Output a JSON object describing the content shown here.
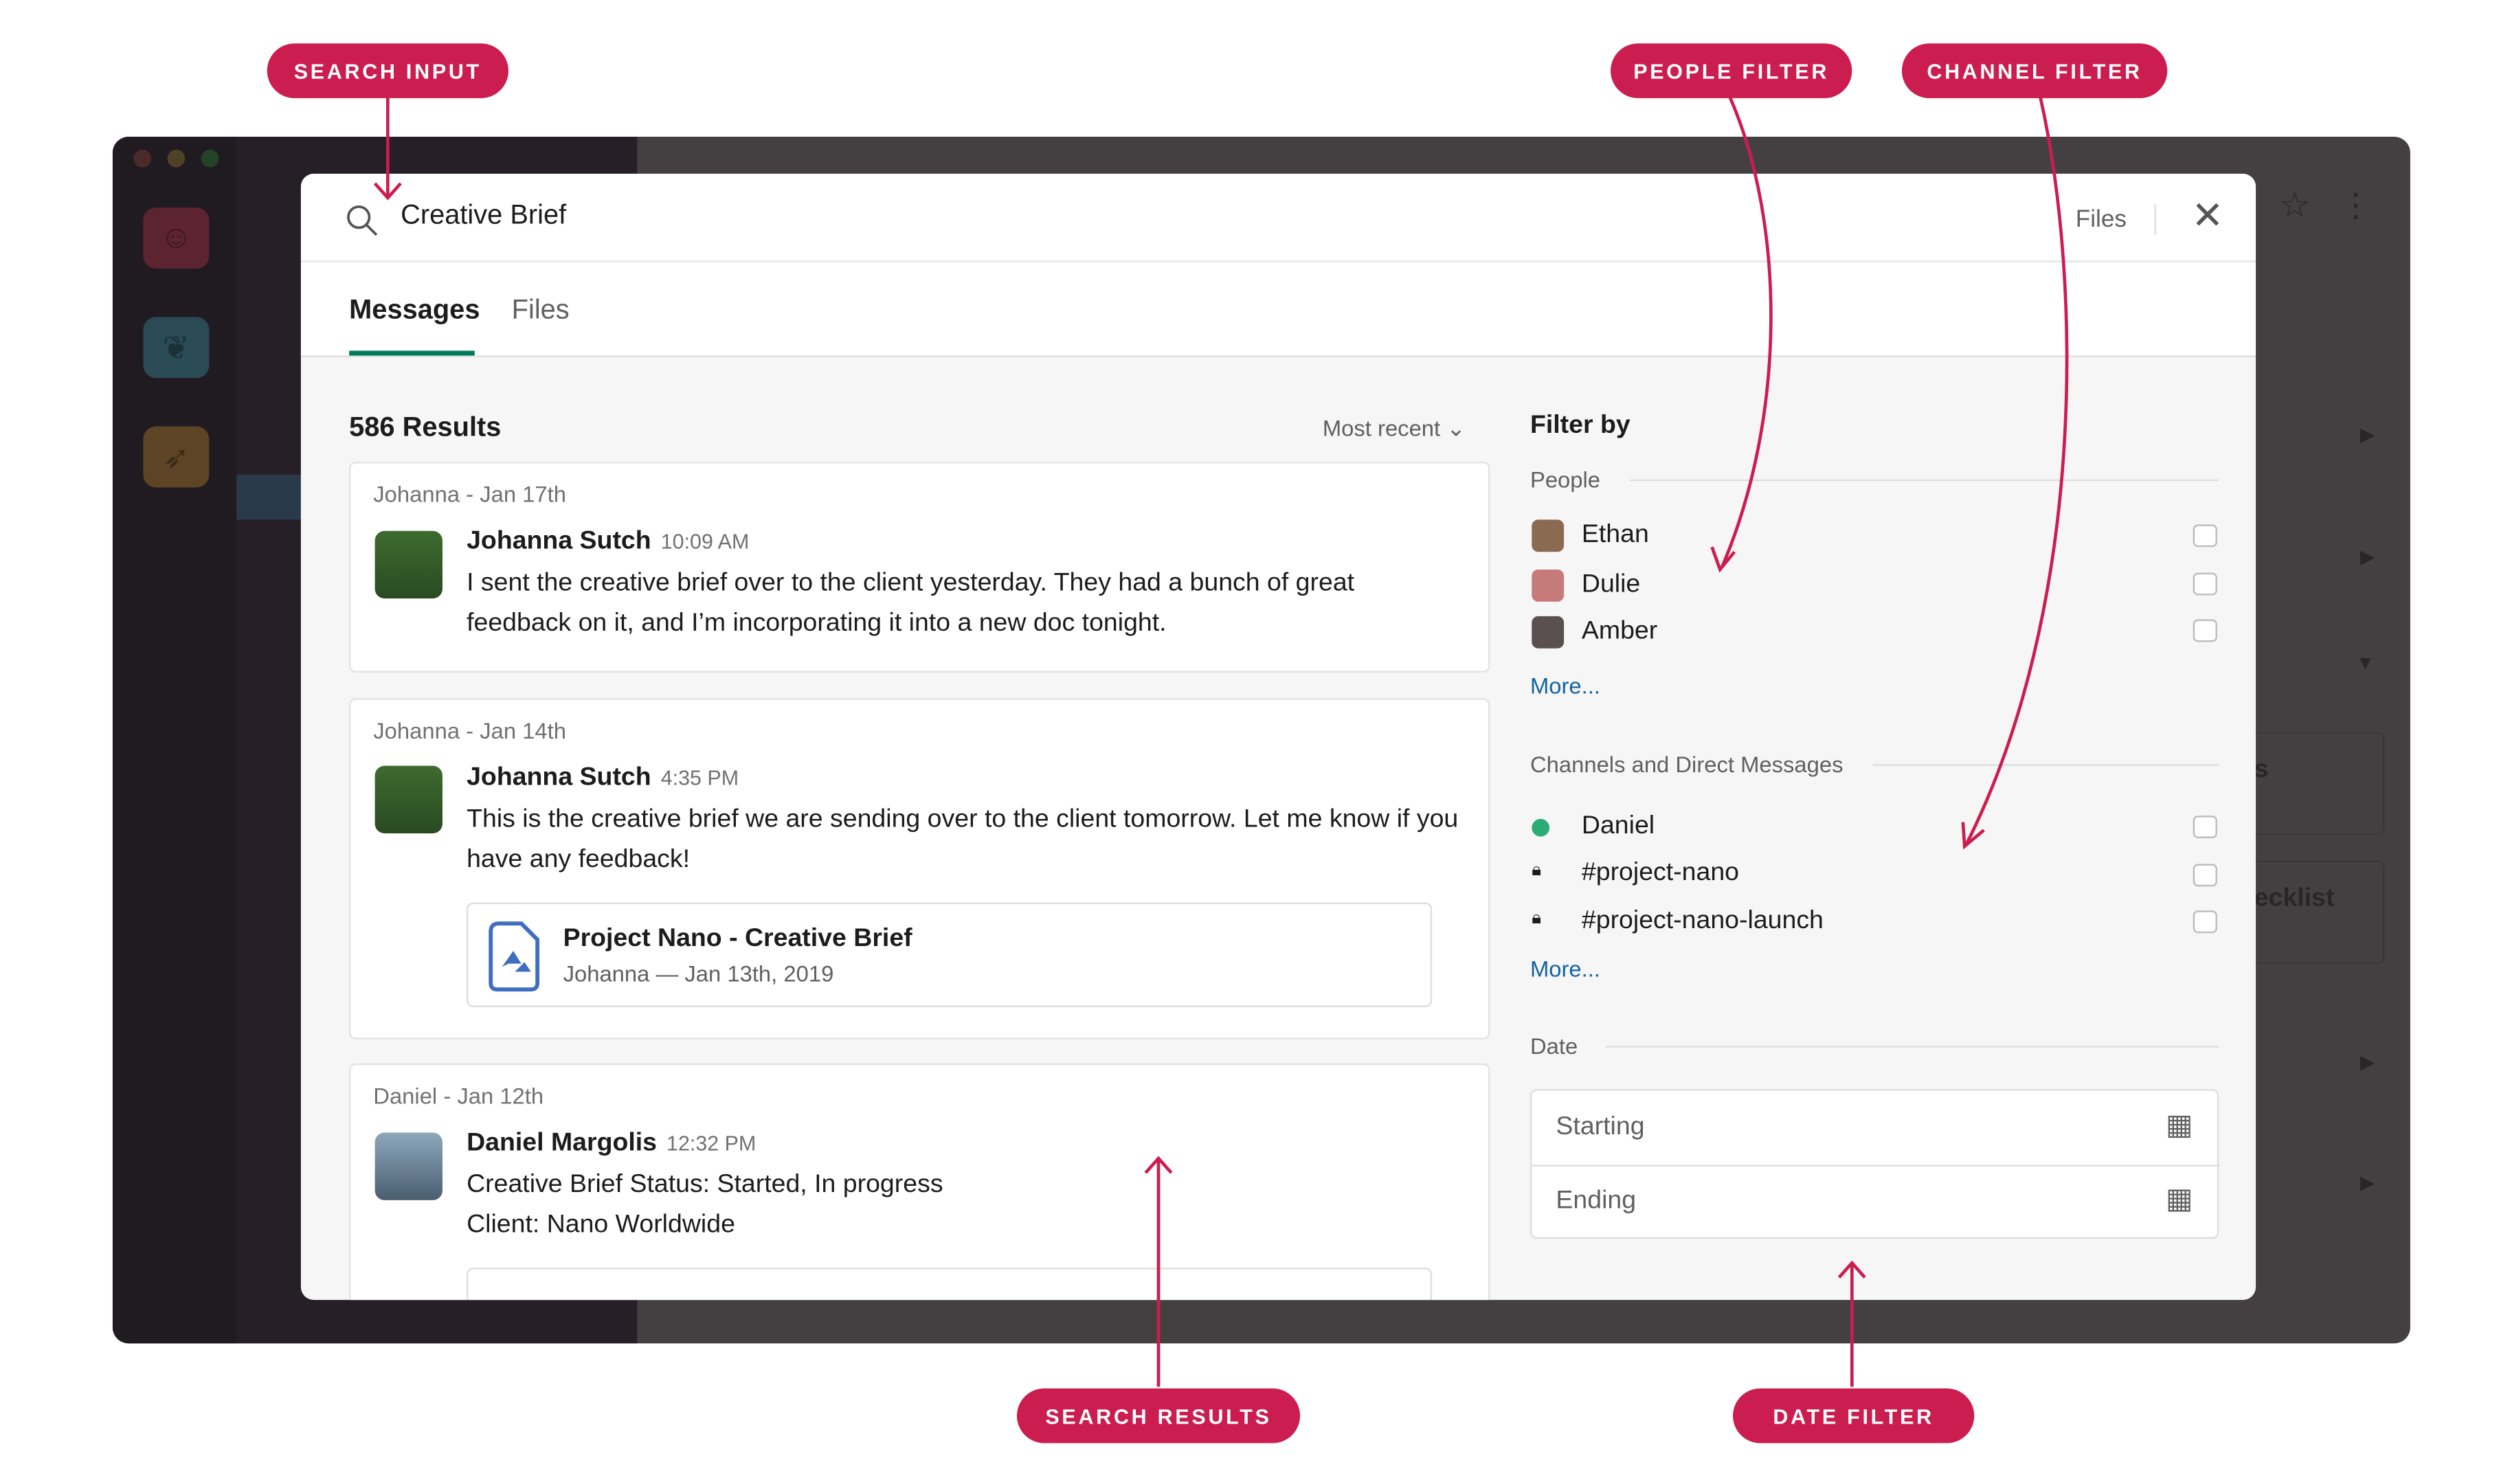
{
  "search": {
    "value": "Creative Brief",
    "files_scope": "Files"
  },
  "tabs": [
    {
      "label": "Messages",
      "active": true
    },
    {
      "label": "Files",
      "active": false
    }
  ],
  "results": {
    "count": "586 Results",
    "sort": "Most recent"
  },
  "messages": [
    {
      "meta": "Johanna - Jan 17th",
      "author": "Johanna Sutch",
      "time": "10:09 AM",
      "text": "I sent the creative brief over to the client yesterday. They had a bunch of great feedback on it, and I’m incorporating it into a new doc tonight."
    },
    {
      "meta": "Johanna - Jan 14th",
      "author": "Johanna Sutch",
      "time": "4:35 PM",
      "text": "This is the creative brief we are sending over to the client tomorrow. Let me know if you have any feedback!",
      "attachment": {
        "title": "Project Nano - Creative Brief",
        "sub": "Johanna — Jan 13th, 2019"
      }
    },
    {
      "meta": "Daniel - Jan 12th",
      "author": "Daniel Margolis",
      "time": "12:32 PM",
      "text": "Creative Brief Status: Started, In progress",
      "text2": "Client: Nano Worldwide"
    }
  ],
  "filter": {
    "title": "Filter by",
    "people_label": "People",
    "people": [
      "Ethan",
      "Dulie",
      "Amber"
    ],
    "more": "More...",
    "channels_label": "Channels and Direct Messages",
    "channels": [
      "Daniel",
      "#project-nano",
      "#project-nano-launch"
    ],
    "date_label": "Date",
    "starting": "Starting",
    "ending": "Ending"
  },
  "background": {
    "checklist_fragment": "ecklist",
    "s_fragment": "s"
  },
  "callouts": {
    "search_input": "SEARCH INPUT",
    "people_filter": "PEOPLE FILTER",
    "channel_filter": "CHANNEL FILTER",
    "search_results": "SEARCH RESULTS",
    "date_filter": "DATE FILTER"
  },
  "colors": {
    "accent": "#cb1d4f",
    "tab_underline": "#007a5a",
    "link": "#1264a3",
    "online": "#2bac76"
  }
}
